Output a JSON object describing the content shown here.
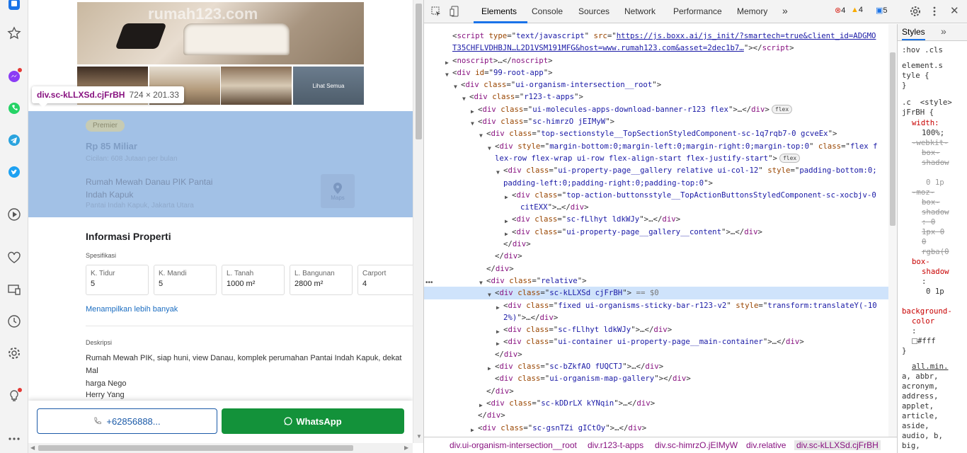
{
  "sidebar": {
    "icons": [
      "browser-app-icon",
      "star-icon",
      "messenger-icon",
      "whatsapp-icon",
      "telegram-icon",
      "twitter-icon",
      "play-icon",
      "heart-icon",
      "device-icon",
      "history-icon",
      "settings-icon",
      "bulb-icon",
      "more-icon"
    ]
  },
  "page": {
    "gallery": {
      "watermark": "rumah123.com",
      "see_all": "Lihat Semua"
    },
    "tooltip": {
      "name": "div.sc-kLLXSd.cjFrBH",
      "dims": "724 × 201.33"
    },
    "listing": {
      "badge": "Premier",
      "price": "Rp 85 Miliar",
      "installment": "Cicilan: 608 Jutaan per bulan",
      "title": "Rumah Mewah Danau PIK Pantai Indah Kapuk",
      "location": "Pantai Indah Kapuk, Jakarta Utara",
      "maps_label": "Maps"
    },
    "info": {
      "title": "Informasi Properti",
      "spec_label": "Spesifikasi",
      "specs": [
        {
          "key": "K. Tidur",
          "value": "5"
        },
        {
          "key": "K. Mandi",
          "value": "5"
        },
        {
          "key": "L. Tanah",
          "value": "1000 m²"
        },
        {
          "key": "L. Bangunan",
          "value": "2800 m²"
        },
        {
          "key": "Carport",
          "value": "4"
        }
      ],
      "show_more": "Menampilkan lebih banyak",
      "desc_label": "Deskripsi",
      "description": "Rumah Mewah PIK, siap huni, view Danau, komplek perumahan Pantai Indah Kapuk, dekat Mal\nharga Nego",
      "agent": "Herry Yang"
    },
    "actions": {
      "phone": "+62856888...",
      "whatsapp": "WhatsApp"
    }
  },
  "devtools": {
    "tabs": [
      "Elements",
      "Console",
      "Sources",
      "Network",
      "Performance",
      "Memory"
    ],
    "more_tabs": "»",
    "errors": "4",
    "warnings": "4",
    "messages": "5",
    "styles_tab": "Styles",
    "breadcrumbs": [
      "div.ui-organism-intersection__root",
      "div.r123-t-apps",
      "div.sc-himrzO.jEIMyW",
      "div.relative",
      "div.sc-kLLXSd.cjFrBH"
    ],
    "selected_suffix": "== $0"
  },
  "colors": {
    "highlight": "#a2c1e6",
    "whatsapp": "#13923a",
    "tag": "#881280",
    "attr": "#994500",
    "value": "#1a1aa6",
    "accent": "#1a73e8"
  }
}
